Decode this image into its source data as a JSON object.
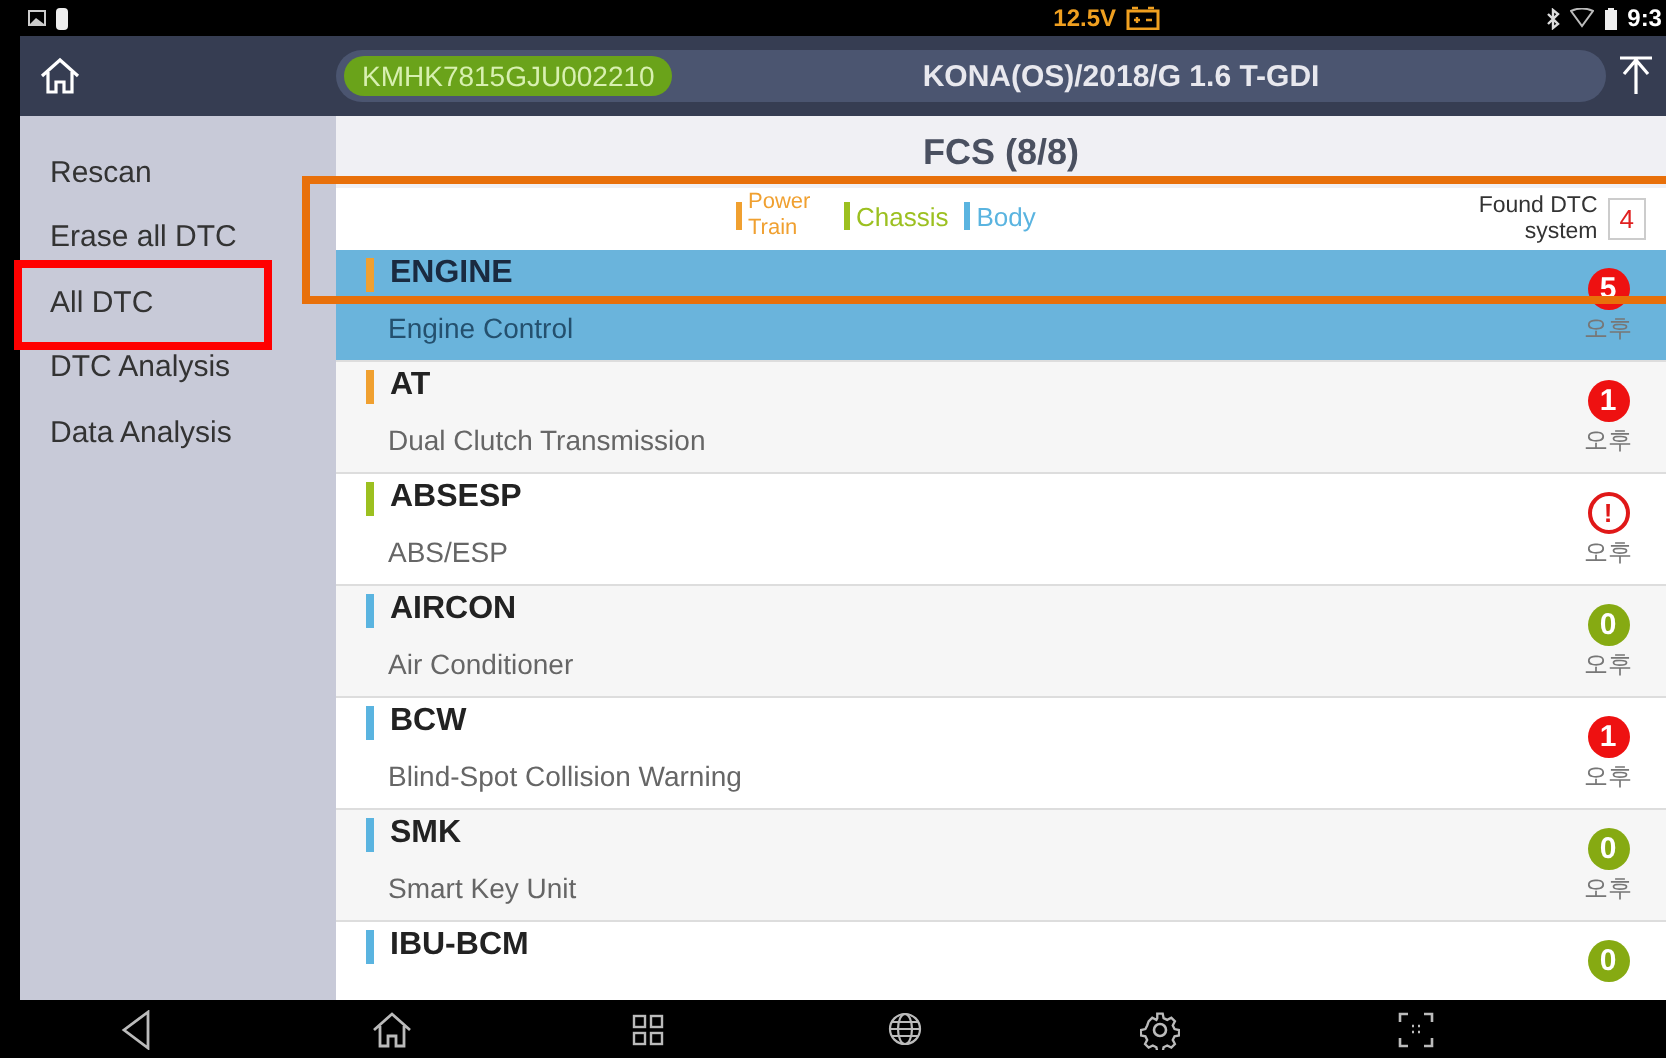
{
  "status_bar": {
    "voltage": "12.5V",
    "clock": "9:3"
  },
  "header": {
    "vin": "KMHK7815GJU002210",
    "vehicle": "KONA(OS)/2018/G 1.6 T-GDI"
  },
  "sidebar": {
    "items": [
      {
        "label": "Rescan",
        "selected": false
      },
      {
        "label": "Erase all DTC",
        "selected": false
      },
      {
        "label": "All DTC",
        "selected": false
      },
      {
        "label": "DTC Analysis",
        "selected": false
      },
      {
        "label": "Data Analysis",
        "selected": false
      }
    ]
  },
  "title": "FCS (8/8)",
  "legend": [
    {
      "label": "Power Train",
      "color": "#f0a030"
    },
    {
      "label": "Chassis",
      "color": "#9cc020"
    },
    {
      "label": "Body",
      "color": "#5ab4e0"
    }
  ],
  "found": {
    "label": "Found DTC system",
    "count": "4"
  },
  "systems": [
    {
      "name": "ENGINE",
      "description": "Engine Control",
      "color": "#f0a030",
      "kind": "fault",
      "badge": "5",
      "time": "오후",
      "selected": true
    },
    {
      "name": "AT",
      "description": "Dual Clutch Transmission",
      "color": "#f0a030",
      "kind": "fault",
      "badge": "1",
      "time": "오후",
      "selected": false
    },
    {
      "name": "ABSESP",
      "description": "ABS/ESP",
      "color": "#9cc020",
      "kind": "warning",
      "badge": "!",
      "time": "오후",
      "selected": false
    },
    {
      "name": "AIRCON",
      "description": "Air Conditioner",
      "color": "#5ab4e0",
      "kind": "ok",
      "badge": "0",
      "time": "오후",
      "selected": false
    },
    {
      "name": "BCW",
      "description": "Blind-Spot Collision Warning",
      "color": "#5ab4e0",
      "kind": "fault",
      "badge": "1",
      "time": "오후",
      "selected": false
    },
    {
      "name": "SMK",
      "description": "Smart Key Unit",
      "color": "#5ab4e0",
      "kind": "ok",
      "badge": "0",
      "time": "오후",
      "selected": false
    },
    {
      "name": "IBU-BCM",
      "color": "#5ab4e0",
      "kind": "ok",
      "badge": "0",
      "selected": false
    }
  ],
  "annotation_boxes": [
    {
      "kind": "sidebar",
      "color": "#ff0000"
    },
    {
      "kind": "legend",
      "color": "#e8700a"
    }
  ]
}
